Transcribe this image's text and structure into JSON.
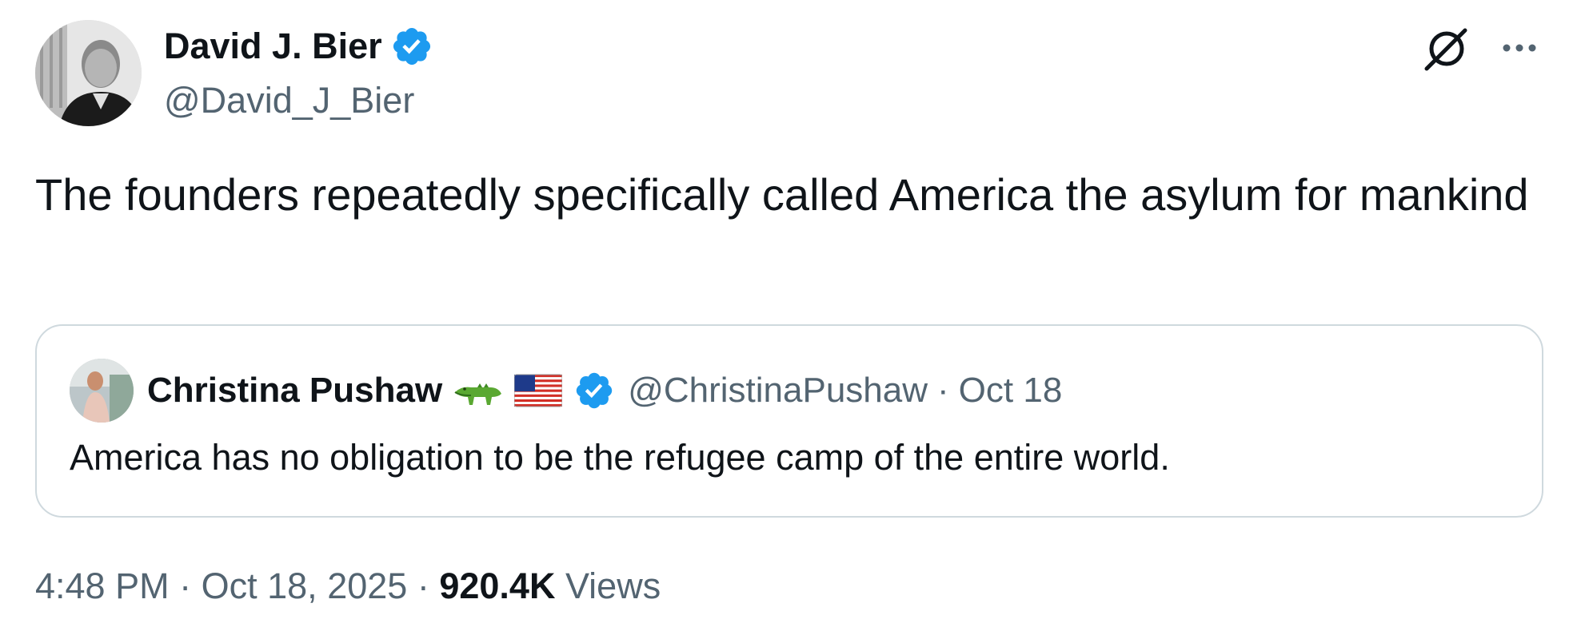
{
  "author": {
    "display_name": "David J. Bier",
    "handle": "@David_J_Bier",
    "verified": true,
    "avatar_icon": "person-portrait-icon"
  },
  "header_actions": {
    "grok_icon": "grok-slash-circle-icon",
    "more_icon": "more-dots-icon"
  },
  "tweet": {
    "text": "The founders repeatedly specifically called America the asylum for mankind"
  },
  "quoted_tweet": {
    "display_name": "Christina Pushaw",
    "name_emojis": [
      "crocodile-emoji",
      "us-flag-emoji"
    ],
    "verified": true,
    "handle": "@ChristinaPushaw",
    "separator": "·",
    "date": "Oct 18",
    "text": "America has no obligation to be the refugee camp of the entire world."
  },
  "meta": {
    "time": "4:48 PM",
    "separator": "·",
    "date": "Oct 18, 2025",
    "views_count": "920.4K",
    "views_label": "Views"
  },
  "colors": {
    "text_primary": "#0f1419",
    "text_secondary": "#536471",
    "verified_blue": "#1d9bf0",
    "border": "#cfd9de"
  }
}
